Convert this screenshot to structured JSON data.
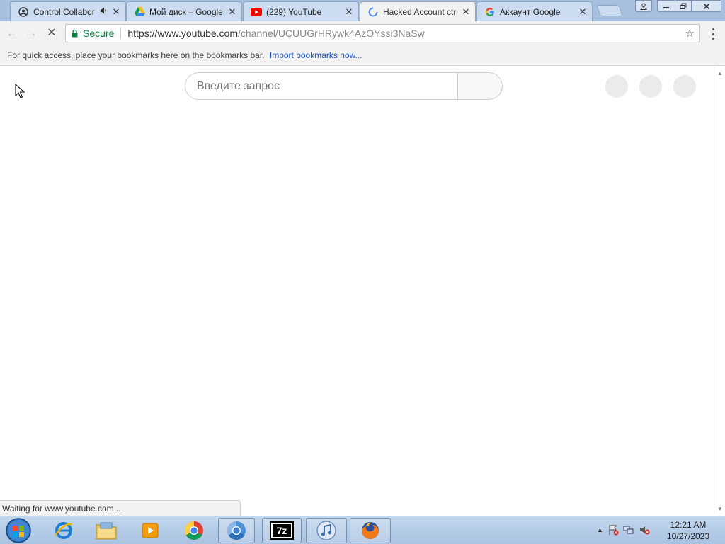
{
  "tabs": [
    {
      "title": "Control Collabor",
      "icon": "collab-icon",
      "audio": true,
      "close": "✕"
    },
    {
      "title": "Мой диск – Google",
      "icon": "google-drive-icon",
      "close": "✕"
    },
    {
      "title": "(229) YouTube",
      "icon": "youtube-icon",
      "close": "✕"
    },
    {
      "title": "Hacked Account ctr",
      "icon": "loading-spinner-icon",
      "active": true,
      "close": "✕"
    },
    {
      "title": "Аккаунт Google",
      "icon": "google-icon",
      "close": "✕"
    }
  ],
  "toolbar": {
    "back": "←",
    "forward": "→",
    "stop": "✕",
    "secure_label": "Secure",
    "url_scheme_host": "https://www.youtube.com",
    "url_path": "/channel/UCUUGrHRywk4AzOYssi3NaSw",
    "star": "☆"
  },
  "bookmarks": {
    "hint": "For quick access, place your bookmarks here on the bookmarks bar.",
    "import_link": "Import bookmarks now..."
  },
  "page": {
    "search_placeholder": "Введите запрос"
  },
  "status": {
    "text": "Waiting for www.youtube.com..."
  },
  "taskbar": {
    "apps": [
      "start-orb-icon",
      "internet-explorer-icon",
      "file-explorer-icon",
      "media-player-icon",
      "chrome-icon",
      "chromium-icon",
      "7zip-icon",
      "itunes-icon",
      "firefox-icon"
    ],
    "clock_time": "12:21 AM",
    "clock_date": "10/27/2023"
  },
  "colors": {
    "tabstrip": "#a7c0e0",
    "secure_green": "#0b8043",
    "link_blue": "#1a55c9",
    "youtube_red": "#ff0000"
  }
}
